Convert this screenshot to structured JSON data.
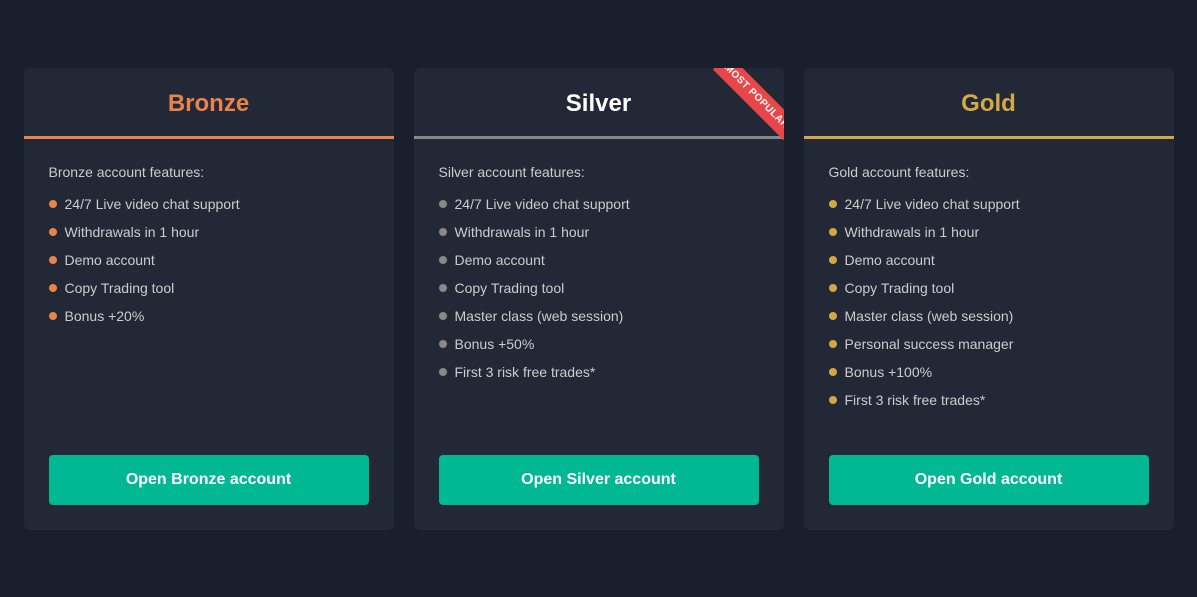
{
  "cards": [
    {
      "id": "bronze",
      "title": "Bronze",
      "accent_color": "#e8834a",
      "divider_color": "#e8834a",
      "features_label": "Bronze account features:",
      "features": [
        "24/7 Live video chat support",
        "Withdrawals in 1 hour",
        "Demo account",
        "Copy Trading tool",
        "Bonus +20%"
      ],
      "cta_label": "Open Bronze account",
      "most_popular": false
    },
    {
      "id": "silver",
      "title": "Silver",
      "accent_color": "#888888",
      "divider_color": "#888888",
      "features_label": "Silver account features:",
      "features": [
        "24/7 Live video chat support",
        "Withdrawals in 1 hour",
        "Demo account",
        "Copy Trading tool",
        "Master class (web session)",
        "Bonus +50%",
        "First 3 risk free trades*"
      ],
      "cta_label": "Open Silver account",
      "most_popular": true,
      "ribbon_text": "MOST POPULAR"
    },
    {
      "id": "gold",
      "title": "Gold",
      "accent_color": "#d4a843",
      "divider_color": "#d4a843",
      "features_label": "Gold account features:",
      "features": [
        "24/7 Live video chat support",
        "Withdrawals in 1 hour",
        "Demo account",
        "Copy Trading tool",
        "Master class (web session)",
        "Personal success manager",
        "Bonus +100%",
        "First 3 risk free trades*"
      ],
      "cta_label": "Open Gold account",
      "most_popular": false
    }
  ]
}
